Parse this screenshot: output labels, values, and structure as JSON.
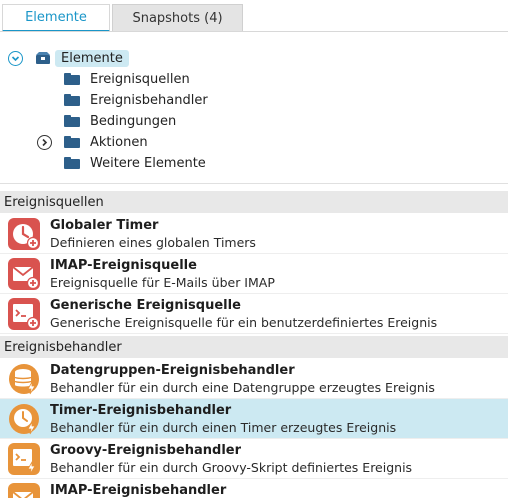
{
  "tabs": [
    {
      "label": "Elemente",
      "active": true
    },
    {
      "label": "Snapshots (4)",
      "active": false
    }
  ],
  "tree": {
    "root": {
      "label": "Elemente",
      "icon": "open-box-icon",
      "expanded": true
    },
    "children": [
      {
        "label": "Ereignisquellen",
        "icon": "folder-icon",
        "expandable": false
      },
      {
        "label": "Ereignisbehandler",
        "icon": "folder-icon",
        "expandable": false
      },
      {
        "label": "Bedingungen",
        "icon": "folder-icon",
        "expandable": false
      },
      {
        "label": "Aktionen",
        "icon": "folder-icon",
        "expandable": true
      },
      {
        "label": "Weitere Elemente",
        "icon": "folder-icon",
        "expandable": false
      }
    ]
  },
  "sections": [
    {
      "header": "Ereignisquellen",
      "items": [
        {
          "title": "Globaler Timer",
          "description": "Definieren eines globalen Timers",
          "icon": "clock-plus-icon",
          "color": "#d9534f"
        },
        {
          "title": "IMAP-Ereignisquelle",
          "description": "Ereignisquelle für E-Mails über IMAP",
          "icon": "mail-plus-icon",
          "color": "#d9534f"
        },
        {
          "title": "Generische Ereignisquelle",
          "description": "Generische Ereignisquelle für ein benutzerdefiniertes Ereignis",
          "icon": "script-plus-icon",
          "color": "#d9534f"
        }
      ]
    },
    {
      "header": "Ereignisbehandler",
      "items": [
        {
          "title": "Datengruppen-Ereignisbehandler",
          "description": "Behandler für ein durch eine Datengruppe erzeugtes Ereignis",
          "icon": "database-lightning-icon",
          "color": "#e8943a",
          "selected": false
        },
        {
          "title": "Timer-Ereignisbehandler",
          "description": "Behandler für ein durch einen Timer erzeugtes Ereignis",
          "icon": "clock-lightning-icon",
          "color": "#e8943a",
          "selected": true
        },
        {
          "title": "Groovy-Ereignisbehandler",
          "description": "Behandler für ein durch Groovy-Skript definiertes Ereignis",
          "icon": "script-lightning-icon",
          "color": "#e8943a",
          "selected": false
        },
        {
          "title": "IMAP-Ereignisbehandler",
          "description": "",
          "icon": "mail-lightning-icon",
          "color": "#e8943a",
          "selected": false
        }
      ]
    }
  ],
  "colors": {
    "accent": "#1a96c8",
    "selection": "#cce9f2",
    "source_red": "#d9534f",
    "handler_orange": "#e8943a",
    "folder_blue": "#2d5f8a"
  }
}
